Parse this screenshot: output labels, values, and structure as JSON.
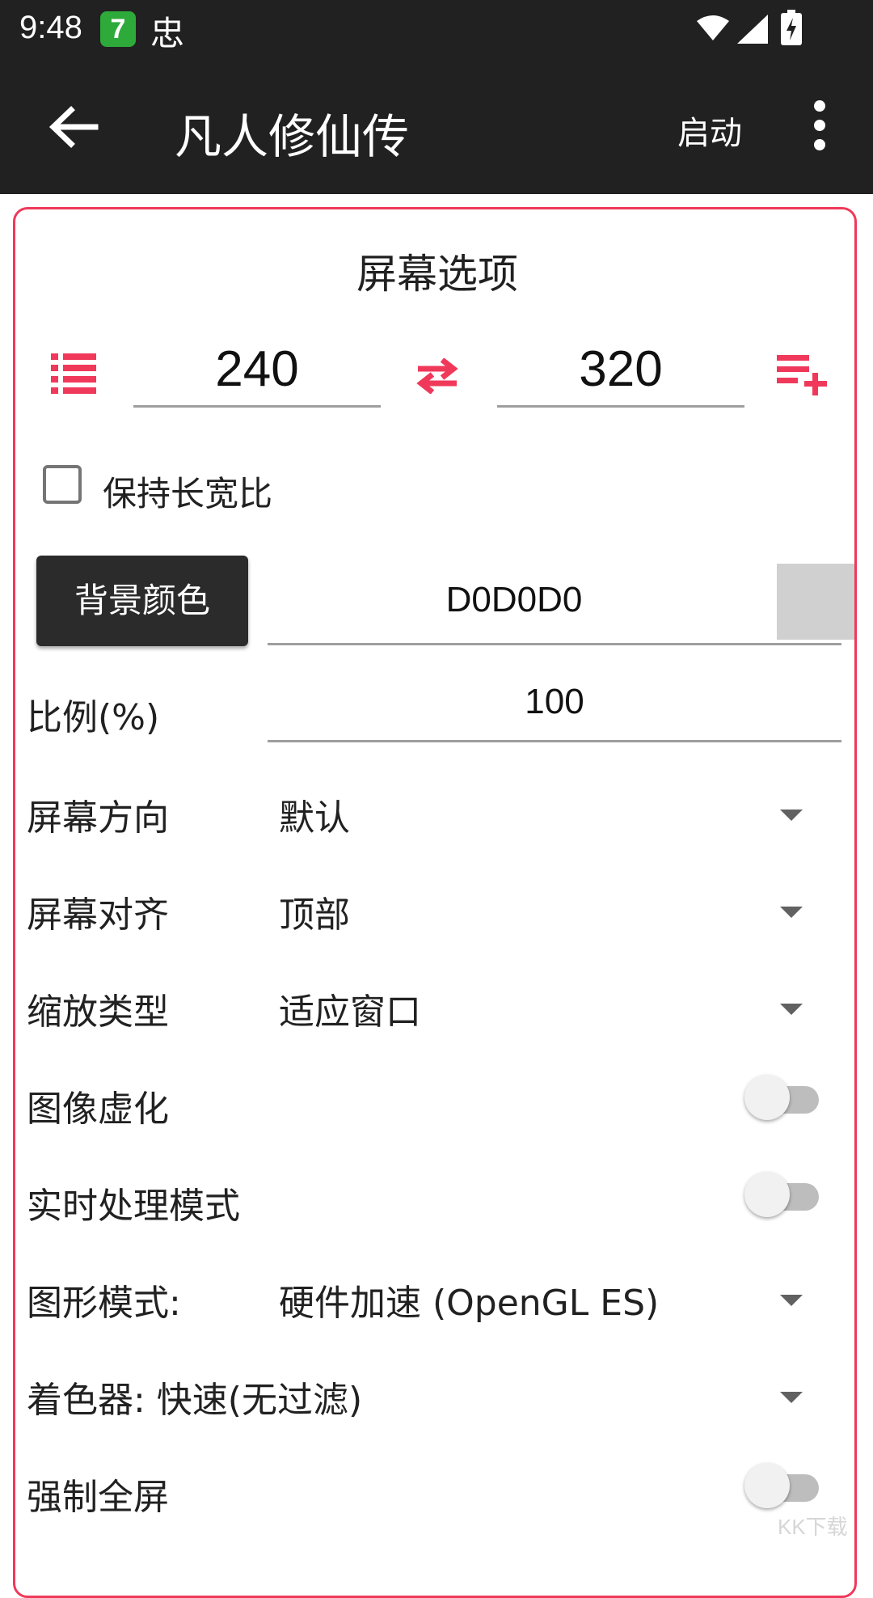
{
  "status_bar": {
    "time": "9:48",
    "notif_app_label": "7",
    "notif_bug_glyph": "忠"
  },
  "app_bar": {
    "title": "凡人修仙传",
    "launch_label": "启动"
  },
  "card": {
    "title": "屏幕选项",
    "width_value": "240",
    "height_value": "320",
    "keep_aspect_label": "保持长宽比",
    "keep_aspect_checked": false,
    "bg_color_button": "背景颜色",
    "bg_color_value": "D0D0D0",
    "bg_color_swatch": "#D0D0D0",
    "scale_label": "比例(%)",
    "scale_value": "100",
    "orientation_label": "屏幕方向",
    "orientation_value": "默认",
    "align_label": "屏幕对齐",
    "align_value": "顶部",
    "zoom_label": "缩放类型",
    "zoom_value": "适应窗口",
    "blur_label": "图像虚化",
    "blur_on": false,
    "realtime_label": "实时处理模式",
    "realtime_on": false,
    "graphics_label": "图形模式:",
    "graphics_value": "硬件加速 (OpenGL ES)",
    "shader_label": "着色器:  快速(无过滤)",
    "fullscreen_label": "强制全屏",
    "fullscreen_on": false
  },
  "watermark": "KK下载",
  "colors": {
    "accent": "#F0395A",
    "appbar": "#212121"
  },
  "icons": [
    "wifi-icon",
    "signal-icon",
    "battery-icon",
    "back-icon",
    "more-icon",
    "list-icon",
    "swap-icon",
    "add-list-icon",
    "dropdown-icon"
  ]
}
